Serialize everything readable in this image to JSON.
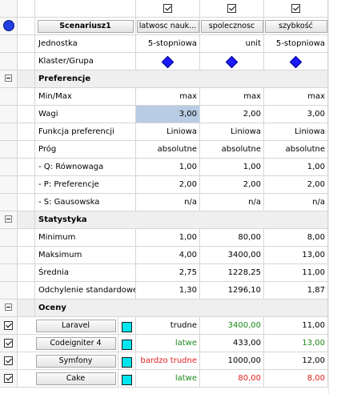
{
  "columns": [
    {
      "header": "latwosc nauk...",
      "checked": true
    },
    {
      "header": "spolecznosc",
      "checked": true
    },
    {
      "header": "szybkość",
      "checked": true
    }
  ],
  "scenario": {
    "label": "Scenariusz1",
    "color": "#1f3fe0"
  },
  "info_rows": [
    {
      "label": "Jednostka",
      "values": [
        "5-stopniowa",
        "unit",
        "5-stopniowa"
      ]
    },
    {
      "label": "Klaster/Grupa",
      "values": [
        "diamond",
        "diamond",
        "diamond"
      ]
    }
  ],
  "groups": {
    "preferences": {
      "title": "Preferencje",
      "rows": [
        {
          "label": "Min/Max",
          "values": [
            "max",
            "max",
            "max"
          ]
        },
        {
          "label": "Wagi",
          "values": [
            "3,00",
            "2,00",
            "3,00"
          ]
        },
        {
          "label": "Funkcja preferencji",
          "values": [
            "Liniowa",
            "Liniowa",
            "Liniowa"
          ]
        },
        {
          "label": "Próg",
          "values": [
            "absolutne",
            "absolutne",
            "absolutne"
          ]
        },
        {
          "label": "- Q: Równowaga",
          "values": [
            "1,00",
            "1,00",
            "1,00"
          ]
        },
        {
          "label": "- P: Preferencje",
          "values": [
            "2,00",
            "2,00",
            "2,00"
          ]
        },
        {
          "label": "- S: Gausowska",
          "values": [
            "n/a",
            "n/a",
            "n/a"
          ]
        }
      ]
    },
    "statistics": {
      "title": "Statystyka",
      "rows": [
        {
          "label": "Minimum",
          "values": [
            "1,00",
            "80,00",
            "8,00"
          ]
        },
        {
          "label": "Maksimum",
          "values": [
            "4,00",
            "3400,00",
            "13,00"
          ]
        },
        {
          "label": "Średnia",
          "values": [
            "2,75",
            "1228,25",
            "11,00"
          ]
        },
        {
          "label": "Odchylenie standardowe",
          "values": [
            "1,30",
            "1296,10",
            "1,87"
          ]
        }
      ]
    },
    "ratings": {
      "title": "Oceny",
      "rows": [
        {
          "label": "Laravel",
          "values": [
            "trudne",
            "3400,00",
            "11,00"
          ],
          "colors": [
            "black",
            "green",
            "black"
          ]
        },
        {
          "label": "Codeigniter 4",
          "values": [
            "latwe",
            "433,00",
            "13,00"
          ],
          "colors": [
            "green",
            "black",
            "green"
          ]
        },
        {
          "label": "Symfony",
          "values": [
            "bardzo trudne",
            "1000,00",
            "12,00"
          ],
          "colors": [
            "red",
            "black",
            "black"
          ]
        },
        {
          "label": "Cake",
          "values": [
            "latwe",
            "80,00",
            "8,00"
          ],
          "colors": [
            "green",
            "red",
            "red"
          ]
        }
      ]
    }
  },
  "colors": {
    "accent_blue": "#1f3fe0",
    "swatch_cyan": "#00e5ee",
    "selected_cell": "#b8cce4",
    "green": "#1a8a1a",
    "red": "#e02020"
  }
}
